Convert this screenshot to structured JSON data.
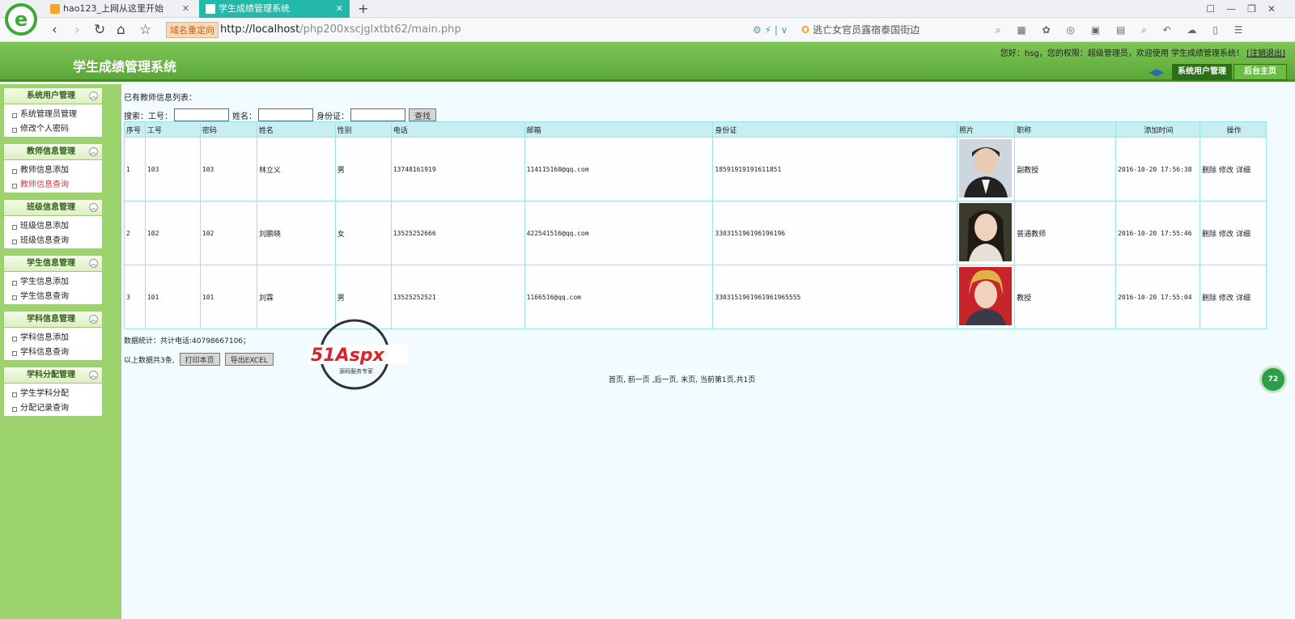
{
  "browser": {
    "logo_letter": "e",
    "tabs": [
      {
        "label": "hao123_上网从这里开始"
      },
      {
        "label": "学生成绩管理系统"
      }
    ],
    "tab_add": "+",
    "redirect_badge": "域名重定向",
    "url_host": "http://localhost",
    "url_path": "/php200xscjglxtbt62/main.php",
    "search_placeholder": "逃亡女官员露宿泰国街边"
  },
  "app": {
    "title": "学生成绩管理系统",
    "welcome": "您好：hsg，您的权限：超级管理员，欢迎使用 学生成绩管理系统！",
    "logout": "[注销退出]",
    "topnav": {
      "active": "系统用户管理",
      "home": "后台主页"
    }
  },
  "sidebar": {
    "groups": [
      {
        "title": "系统用户管理",
        "items": [
          "系统管理员管理",
          "修改个人密码"
        ]
      },
      {
        "title": "教师信息管理",
        "items": [
          "教师信息添加",
          "教师信息查询"
        ]
      },
      {
        "title": "班级信息管理",
        "items": [
          "班级信息添加",
          "班级信息查询"
        ]
      },
      {
        "title": "学生信息管理",
        "items": [
          "学生信息添加",
          "学生信息查询"
        ]
      },
      {
        "title": "学科信息管理",
        "items": [
          "学科信息添加",
          "学科信息查询"
        ]
      },
      {
        "title": "学科分配管理",
        "items": [
          "学生学科分配",
          "分配记录查询"
        ]
      }
    ]
  },
  "main": {
    "list_title": "已有教师信息列表：",
    "search": {
      "label": "搜索：",
      "field_id": "工号：",
      "field_name": "姓名：",
      "field_idcard": "身份证：",
      "button": "查找"
    },
    "table": {
      "headers": [
        "序号",
        "工号",
        "密码",
        "姓名",
        "性别",
        "电话",
        "邮箱",
        "身份证",
        "照片",
        "职称",
        "添加时间",
        "操作"
      ],
      "rows": [
        {
          "no": "1",
          "id": "103",
          "pwd": "103",
          "name": "林立义",
          "gender": "男",
          "phone": "13748161919",
          "email": "114115160@qq.com",
          "idcard": "18591919191611851",
          "title": "副教授",
          "time": "2016-10-20 17:56:38"
        },
        {
          "no": "2",
          "id": "102",
          "pwd": "102",
          "name": "刘鹏晓",
          "gender": "女",
          "phone": "13525252666",
          "email": "422541516@qq.com",
          "idcard": "330315196196196196",
          "title": "普通教师",
          "time": "2016-10-20 17:55:46"
        },
        {
          "no": "3",
          "id": "101",
          "pwd": "101",
          "name": "刘霖",
          "gender": "男",
          "phone": "13525252521",
          "email": "1166516@qq.com",
          "idcard": "3303151961961961965555",
          "title": "教授",
          "time": "2016-10-20 17:55:04"
        }
      ],
      "ops": {
        "delete": "删除",
        "edit": "修改",
        "detail": "详细"
      }
    },
    "stats": "数据统计：共计电话:40798667106；",
    "total": "以上数据共3条,",
    "print_button": "打印本页",
    "export_button": "导出EXCEL",
    "pagination": "首页, 前一页 ,后一页, 末页, 当前第1页,共1页"
  },
  "watermark": {
    "brand": "51Aspx",
    "slogan": "源码服务专家"
  },
  "float_button": "72"
}
